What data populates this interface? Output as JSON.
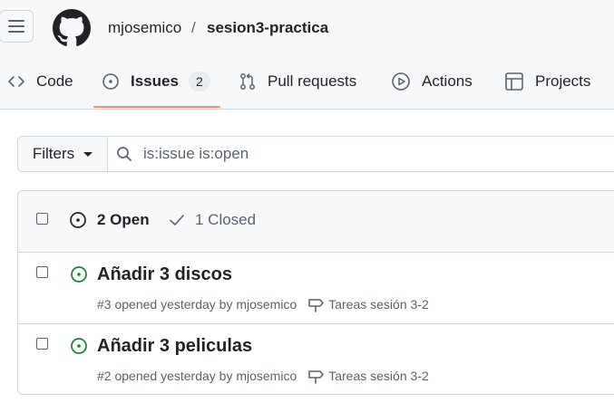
{
  "header": {
    "owner": "mjosemico",
    "separator": "/",
    "repo": "sesion3-practica"
  },
  "tabs": [
    {
      "label": "Code",
      "icon": "code-icon"
    },
    {
      "label": "Issues",
      "icon": "issue-opened-icon",
      "counter": "2",
      "selected": true
    },
    {
      "label": "Pull requests",
      "icon": "git-pull-request-icon"
    },
    {
      "label": "Actions",
      "icon": "play-icon"
    },
    {
      "label": "Projects",
      "icon": "table-icon"
    }
  ],
  "filter": {
    "button_label": "Filters",
    "query": "is:issue is:open"
  },
  "issues_box": {
    "open_label": "2 Open",
    "closed_label": "1 Closed",
    "items": [
      {
        "title": "Añadir 3 discos",
        "meta": "#3 opened yesterday by mjosemico",
        "milestone": "Tareas sesión 3-2"
      },
      {
        "title": "Añadir 3 peliculas",
        "meta": "#2 opened yesterday by mjosemico",
        "milestone": "Tareas sesión 3-2"
      }
    ]
  },
  "colors": {
    "open_green": "#1a7f37",
    "tab_underline": "#fd8c73",
    "border": "#d0d7de",
    "muted_text": "#59636e"
  }
}
